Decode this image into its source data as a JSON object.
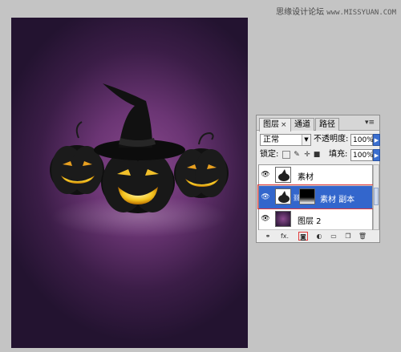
{
  "watermark": {
    "text": "思缘设计论坛",
    "site": "www.MISSYUAN.COM"
  },
  "panel": {
    "tabs": [
      {
        "label": "图层",
        "close": "×"
      },
      {
        "label": "通道"
      },
      {
        "label": "路径"
      }
    ],
    "menu_glyph": "▾≡",
    "blend_mode": "正常",
    "opacity_label": "不透明度:",
    "opacity_value": "100%",
    "lock_label": "锁定:",
    "fill_label": "填充:",
    "fill_value": "100%",
    "layers": [
      {
        "name": "素材"
      },
      {
        "name": "素材 副本"
      },
      {
        "name": "图层 2"
      }
    ],
    "footer_fx": "fx."
  },
  "colors": {
    "selection": "#3366cc",
    "highlight": "#e23a3a",
    "canvas_center": "#8a4a8e",
    "canvas_edge": "#231330"
  },
  "icons": [
    "eye-icon",
    "link-icon",
    "fx-icon",
    "add-mask-icon",
    "adjustment-icon",
    "group-folder-icon",
    "new-layer-icon",
    "trash-icon",
    "lock-icon",
    "brush-icon",
    "move-icon"
  ]
}
